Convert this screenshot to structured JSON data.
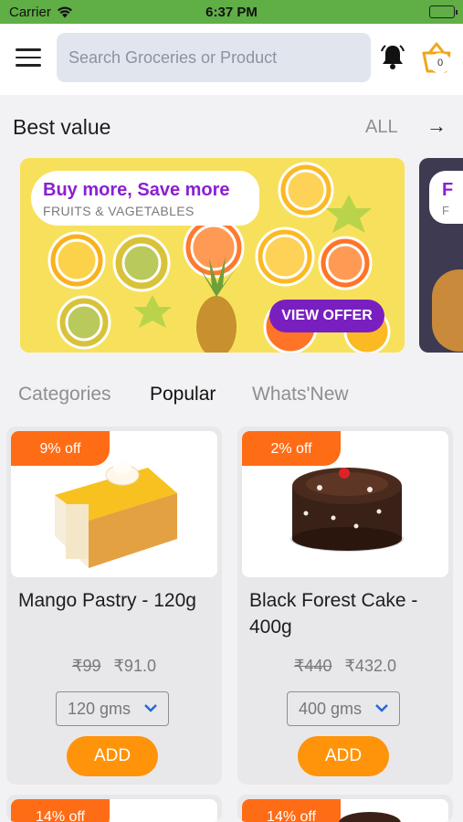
{
  "status_bar": {
    "carrier": "Carrier",
    "time": "6:37 PM"
  },
  "header": {
    "search_placeholder": "Search Groceries or Product",
    "cart_count": "0"
  },
  "best_value": {
    "title": "Best value",
    "all_label": "ALL",
    "arrow": "→",
    "banners": [
      {
        "title": "Buy more, Save more",
        "subtitle": "FRUITS & VAGETABLES",
        "button": "VIEW OFFER"
      },
      {
        "title": "F",
        "subtitle": "F"
      }
    ]
  },
  "tabs": [
    {
      "label": "Categories",
      "active": false
    },
    {
      "label": "Popular",
      "active": true
    },
    {
      "label": "Whats'New",
      "active": false
    }
  ],
  "products": [
    {
      "badge": "9% off",
      "name": "Mango Pastry - 120g",
      "mrp": "₹99",
      "price": "₹91.0",
      "weight": "120 gms",
      "add": "ADD"
    },
    {
      "badge": "2% off",
      "name": "Black Forest Cake - 400g",
      "mrp": "₹440",
      "price": "₹432.0",
      "weight": "400 gms",
      "add": "ADD"
    },
    {
      "badge": "14% off"
    },
    {
      "badge": "14% off"
    }
  ],
  "colors": {
    "status_bar": "#5fae46",
    "accent_orange": "#ff930a",
    "badge_orange": "#ff6c16",
    "offer_purple": "#8b1fd1"
  }
}
